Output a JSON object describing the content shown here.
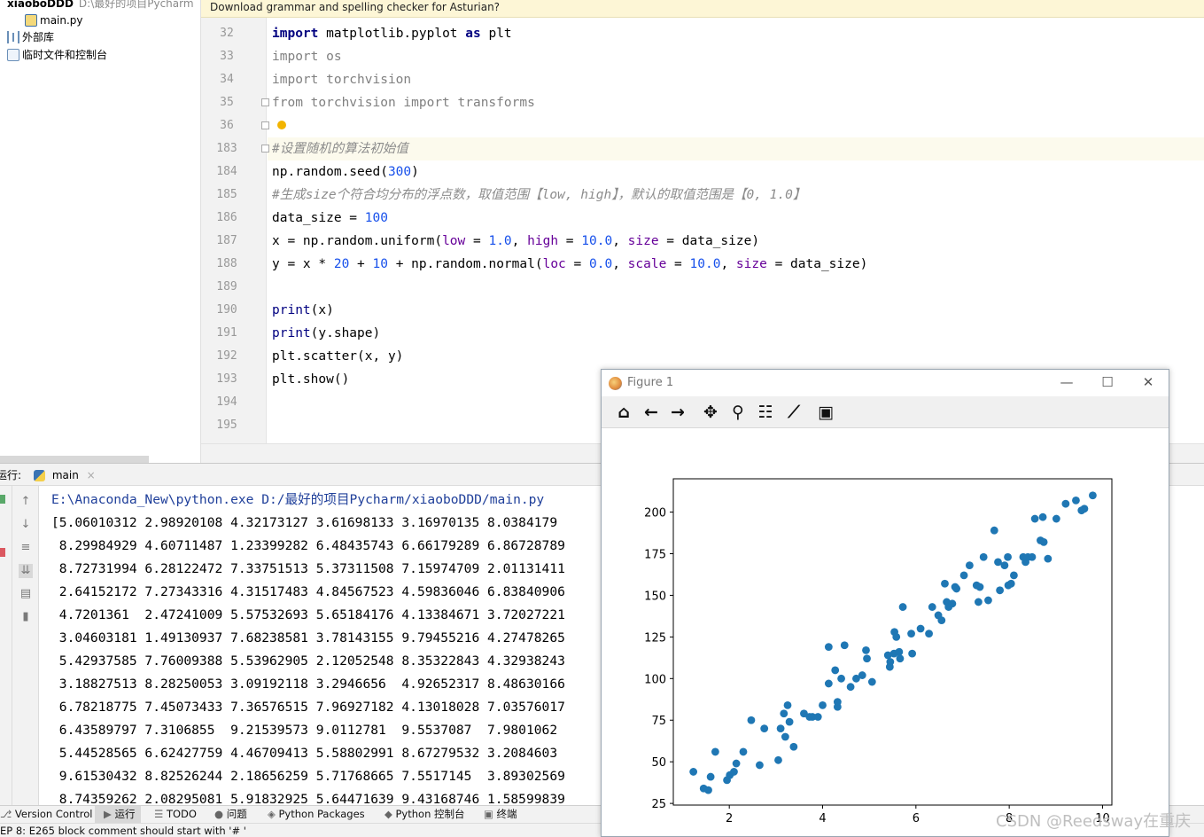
{
  "project": {
    "root_name": "xiaoboDDD",
    "root_path": "D:\\最好的项目Pycharm",
    "file": "main.py",
    "external_libs": "外部库",
    "scratches": "临时文件和控制台"
  },
  "banner": {
    "text": "Download grammar and spelling checker for Asturian?"
  },
  "editor": {
    "lines": [
      {
        "n": "32",
        "html": "<span class=\"kw\">import</span> matplotlib.pyplot <span class=\"kw\">as</span> plt"
      },
      {
        "n": "33",
        "html": "<span class=\"kwg\">import os</span>"
      },
      {
        "n": "34",
        "html": "<span class=\"kwg\">import torchvision</span>"
      },
      {
        "n": "35",
        "html": "<span class=\"kwg\">from torchvision import transforms</span>"
      },
      {
        "n": "36",
        "html": ""
      },
      {
        "n": "183",
        "html": "<span class=\"cm\">#设置随机的算法初始值</span>"
      },
      {
        "n": "184",
        "html": "np.random.seed(<span class=\"num\">300</span>)"
      },
      {
        "n": "185",
        "html": "<span class=\"cm\">#生成size个符合均分布的浮点数，取值范围【low, high】，默认的取值范围是【0, 1.0】</span>"
      },
      {
        "n": "186",
        "html": "data_size = <span class=\"num\">100</span>"
      },
      {
        "n": "187",
        "html": "x = np.random.uniform(<span class=\"prm\">low</span> = <span class=\"num\">1.0</span>, <span class=\"prm\">high</span> = <span class=\"num\">10.0</span>, <span class=\"prm\">size</span> = data_size)"
      },
      {
        "n": "188",
        "html": "y = x * <span class=\"num\">20</span> + <span class=\"num\">10</span> + np.random.normal(<span class=\"prm\">loc</span> = <span class=\"num\">0.0</span>, <span class=\"prm\">scale</span> = <span class=\"num\">10.0</span>, <span class=\"prm\">size</span> = data_size)"
      },
      {
        "n": "189",
        "html": ""
      },
      {
        "n": "190",
        "html": "<span class=\"fn\">print</span>(x)"
      },
      {
        "n": "191",
        "html": "<span class=\"fn\">print</span>(y.shape)"
      },
      {
        "n": "192",
        "html": "plt.scatter(x, y)"
      },
      {
        "n": "193",
        "html": "plt.show()"
      },
      {
        "n": "194",
        "html": ""
      },
      {
        "n": "195",
        "html": ""
      }
    ]
  },
  "run": {
    "label": "运行:",
    "tab": "main",
    "lines": [
      "E:\\Anaconda_New\\python.exe D:/最好的项目Pycharm/xiaoboDDD/main.py",
      "[5.06010312 2.98920108 4.32173127 3.61698133 3.16970135 8.0384179",
      " 8.29984929 4.60711487 1.23399282 6.48435743 6.66179289 6.86728789",
      " 8.72731994 6.28122472 7.33751513 5.37311508 7.15974709 2.01131411",
      " 2.64152172 7.27343316 4.31517483 4.84567523 4.59836046 6.83840906",
      " 4.7201361  2.47241009 5.57532693 5.65184176 4.13384671 3.72027221",
      " 3.04603181 1.49130937 7.68238581 3.78143155 9.79455216 4.27478265",
      " 5.42937585 7.76009388 5.53962905 2.12052548 8.35322843 4.32938243",
      " 3.18827513 8.28250053 3.09192118 3.2946656  4.92652317 8.48630166",
      " 6.78218775 7.45073433 7.36576515 7.96927182 4.13018028 7.03576017",
      " 6.43589797 7.3106855  9.21539573 9.0112781  9.5537087  7.9801062",
      " 5.44528565 6.62427759 4.46709413 5.58802991 8.67279532 3.2084603",
      " 9.61530432 8.82526244 2.18656259 5.71768665 7.5517145  3.89302569",
      " 8.74359262 2.08295081 5.91832925 5.64471639 9.43168746 1.58599839"
    ]
  },
  "toolbar_bottom": {
    "version_control": "Version Control",
    "run": "运行",
    "todo": "TODO",
    "problems": "问题",
    "packages": "Python Packages",
    "console": "Python 控制台",
    "terminal": "终端"
  },
  "status": {
    "text": "EP 8: E265 block comment should start with '# '"
  },
  "figure": {
    "title": "Figure 1"
  },
  "watermark": "CSDN @Reedsway在重庆",
  "chart_data": {
    "type": "scatter",
    "color": "#1f77b4",
    "xlim": [
      0.8,
      10.2
    ],
    "ylim": [
      24,
      220
    ],
    "xticks": [
      2,
      4,
      6,
      8,
      10
    ],
    "yticks": [
      25,
      50,
      75,
      100,
      125,
      150,
      175,
      200
    ],
    "points": [
      [
        1.23,
        44
      ],
      [
        1.45,
        34
      ],
      [
        1.55,
        33
      ],
      [
        1.6,
        41
      ],
      [
        1.7,
        56
      ],
      [
        1.95,
        39
      ],
      [
        2.01,
        42
      ],
      [
        2.1,
        44
      ],
      [
        2.15,
        49
      ],
      [
        2.3,
        56
      ],
      [
        2.47,
        75
      ],
      [
        2.65,
        48
      ],
      [
        2.75,
        70
      ],
      [
        3.05,
        51
      ],
      [
        3.1,
        70
      ],
      [
        3.17,
        79
      ],
      [
        3.2,
        65
      ],
      [
        3.25,
        84
      ],
      [
        3.29,
        74
      ],
      [
        3.38,
        59
      ],
      [
        3.6,
        79
      ],
      [
        3.72,
        77
      ],
      [
        3.78,
        77
      ],
      [
        3.9,
        77
      ],
      [
        4.0,
        84
      ],
      [
        4.13,
        119
      ],
      [
        4.13,
        97
      ],
      [
        4.27,
        105
      ],
      [
        4.32,
        83
      ],
      [
        4.32,
        86
      ],
      [
        4.4,
        100
      ],
      [
        4.47,
        120
      ],
      [
        4.6,
        95
      ],
      [
        4.72,
        100
      ],
      [
        4.85,
        102
      ],
      [
        4.93,
        117
      ],
      [
        4.95,
        112
      ],
      [
        5.06,
        98
      ],
      [
        5.4,
        114
      ],
      [
        5.44,
        107
      ],
      [
        5.45,
        110
      ],
      [
        5.53,
        115
      ],
      [
        5.54,
        128
      ],
      [
        5.58,
        125
      ],
      [
        5.64,
        116
      ],
      [
        5.66,
        112
      ],
      [
        5.72,
        143
      ],
      [
        5.9,
        127
      ],
      [
        5.92,
        115
      ],
      [
        6.1,
        130
      ],
      [
        6.28,
        127
      ],
      [
        6.35,
        143
      ],
      [
        6.48,
        138
      ],
      [
        6.55,
        135
      ],
      [
        6.62,
        157
      ],
      [
        6.66,
        146
      ],
      [
        6.7,
        143
      ],
      [
        6.78,
        145
      ],
      [
        6.84,
        155
      ],
      [
        6.87,
        154
      ],
      [
        7.03,
        162
      ],
      [
        7.15,
        168
      ],
      [
        7.3,
        156
      ],
      [
        7.34,
        146
      ],
      [
        7.37,
        155
      ],
      [
        7.45,
        173
      ],
      [
        7.55,
        147
      ],
      [
        7.68,
        189
      ],
      [
        7.76,
        170
      ],
      [
        7.8,
        153
      ],
      [
        7.9,
        168
      ],
      [
        7.97,
        173
      ],
      [
        7.98,
        156
      ],
      [
        8.04,
        157
      ],
      [
        8.1,
        162
      ],
      [
        8.3,
        173
      ],
      [
        8.35,
        170
      ],
      [
        8.4,
        173
      ],
      [
        8.49,
        173
      ],
      [
        8.55,
        196
      ],
      [
        8.67,
        183
      ],
      [
        8.72,
        197
      ],
      [
        8.74,
        182
      ],
      [
        8.83,
        172
      ],
      [
        9.01,
        196
      ],
      [
        9.21,
        205
      ],
      [
        9.43,
        207
      ],
      [
        9.55,
        201
      ],
      [
        9.61,
        202
      ],
      [
        9.79,
        210
      ]
    ]
  }
}
